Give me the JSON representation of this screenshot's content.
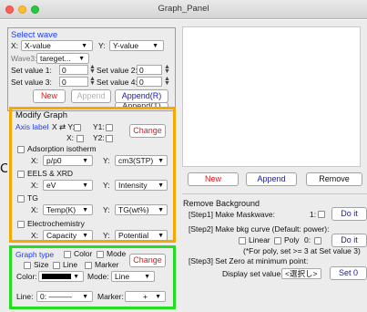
{
  "window": {
    "title": "Graph_Panel"
  },
  "select_wave": {
    "heading": "Select wave",
    "x_label": "X:",
    "x_value": "X-value",
    "y_label": "Y:",
    "y_value": "Y-value",
    "wave3_label": "Wave3:",
    "wave3_value": "tareget...",
    "set1_label": "Set value 1:",
    "set1_value": "0",
    "set2_label": "Set value 2:",
    "set2_value": "0",
    "set3_label": "Set value 3:",
    "set3_value": "0",
    "set4_label": "Set value 4:",
    "set4_value": "0",
    "new_button": "New",
    "append_button": "Append",
    "append_r_button": "Append(R)",
    "hidden_button": "Append(T)"
  },
  "modify_graph": {
    "heading": "Modify Graph",
    "axis_label": "Axis label",
    "swap_label": "X ⇄ Y:",
    "y1_label": "Y1:",
    "x_label": "X:",
    "y2_label": "Y2:",
    "change_button": "Change",
    "adsorption": {
      "label": "Adsorption isotherm",
      "x_label": "X:",
      "x_value": "p/p0",
      "y_label": "Y:",
      "y_value": "cm3(STP)"
    },
    "eels": {
      "label": "EELS & XRD",
      "x_label": "X:",
      "x_value": "eV",
      "y_label": "Y:",
      "y_value": "Intensity"
    },
    "tg": {
      "label": "TG",
      "x_label": "X:",
      "x_value": "Temp(K)",
      "y_label": "Y:",
      "y_value": "TG(wt%)"
    },
    "electro": {
      "label": "Electrochemistry",
      "x_label": "X:",
      "x_value": "Capacity",
      "y_label": "Y:",
      "y_value": "Potential"
    }
  },
  "graph_type": {
    "heading": "Graph type",
    "color_check": "Color",
    "mode_check": "Mode",
    "size_check": "Size",
    "line_check": "Line",
    "marker_check": "Marker",
    "change_button": "Change",
    "color_label": "Color:",
    "mode_label": "Mode:",
    "mode_value": "Line",
    "line_label": "Line:",
    "line_value": "0: ———",
    "marker_label": "Marker:",
    "marker_value": "+",
    "swatch_color": "#000000"
  },
  "graph_buttons": {
    "new": "New",
    "append": "Append",
    "remove": "Remove"
  },
  "remove_bg": {
    "heading": "Remove Background",
    "step1": "[Step1] Make Maskwave:",
    "step1_value": "1:",
    "do_it": "Do it",
    "step2": "[Step2] Make bkg curve (Default: power):",
    "linear": "Linear",
    "poly": "Poly",
    "poly_value": "0:",
    "note": "(*For poly, set >= 3 at Set value 3)",
    "step3": "[Step3] Set Zero at minimum point:",
    "display_label": "Display set value:",
    "display_value": "<選択し>",
    "set0": "Set 0"
  },
  "side_text": "CS"
}
